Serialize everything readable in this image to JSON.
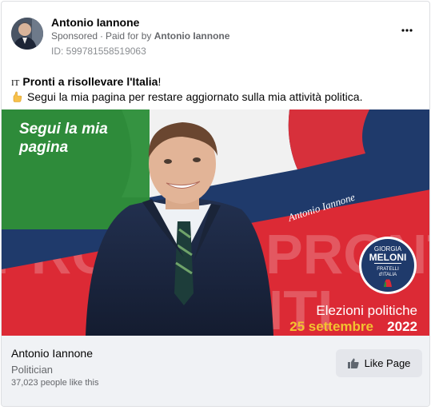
{
  "post": {
    "author": "Antonio Iannone",
    "sponsored": "Sponsored",
    "paid_for_prefix": "Paid for by",
    "paid_for_by": "Antonio Iannone",
    "ad_id": "ID: 599781558519063",
    "more_label": "•••",
    "lang_tag": "IT",
    "headline": "Pronti a risollevare l'Italia",
    "headline_suffix": "!",
    "body": "Segui la mia pagina per restare aggiornato sulla mia attività politica."
  },
  "banner": {
    "follow_line1": "Segui la mia",
    "follow_line2": "pagina",
    "signature": "Antonio Iannone",
    "bg_text": "PRONTI",
    "logo": {
      "top": "GIORGIA",
      "middle": "MELONI",
      "bottom1": "FRATELLI",
      "bottom2": "d'ITALIA"
    },
    "elections_label": "Elezioni politiche",
    "election_day": "25 settembre",
    "election_year": "2022",
    "colors": {
      "green": "#2e8b3a",
      "navy": "#1f3a6b",
      "red": "#dc2a35",
      "gold": "#f2c230"
    }
  },
  "page_card": {
    "name": "Antonio Iannone",
    "category": "Politician",
    "likes": "37,023 people like this",
    "like_button": "Like Page"
  }
}
